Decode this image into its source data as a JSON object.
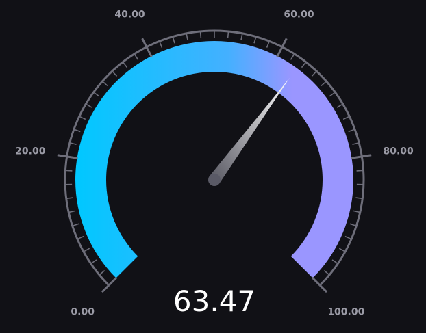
{
  "gauge": {
    "min": 0,
    "max": 100,
    "value": 63.47,
    "value_label": "63.47",
    "major_tick_labels": [
      "0.00",
      "20.00",
      "40.00",
      "60.00",
      "80.00",
      "100.00"
    ],
    "major_tick_values": [
      0,
      20,
      40,
      60,
      80,
      100
    ],
    "minor_tick_step": 2,
    "start_angle_deg": 225,
    "end_angle_deg": -45,
    "colors": {
      "background": "#111116",
      "band_start": "#00c8ff",
      "band_mid": "#44b0ff",
      "band_end": "#9a96ff",
      "scale": "#6e6e7a",
      "tick_label": "#9b9ba6",
      "value_text": "#ffffff",
      "needle_tip": "#ffffff",
      "needle_base": "#5a5a66"
    }
  }
}
